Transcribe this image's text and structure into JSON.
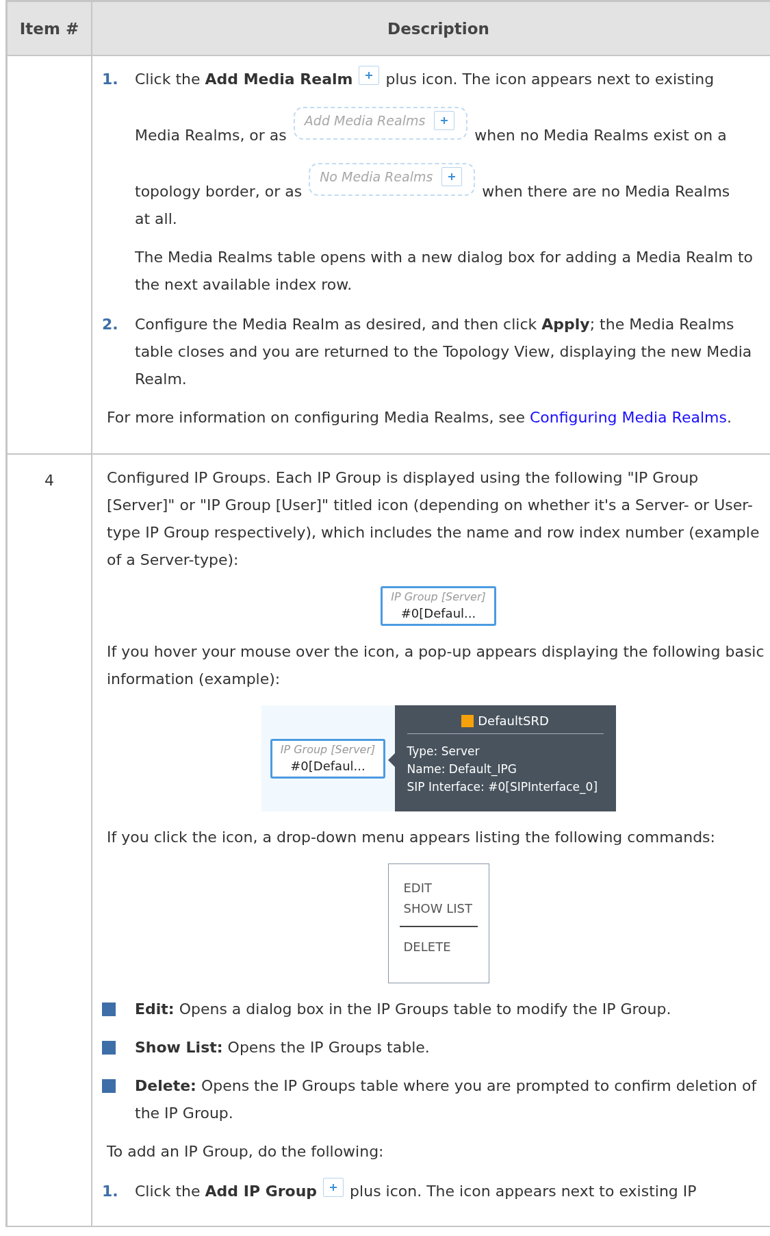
{
  "table": {
    "columns": [
      "Item #",
      "Description"
    ],
    "rows": [
      {
        "item": "",
        "blocks": [
          {
            "kind": "step",
            "number": "1.",
            "lines": [
              [
                {
                  "kind": "text",
                  "text": "Click the **Add Media Realm**"
                },
                {
                  "kind": "plus"
                },
                {
                  "kind": "text",
                  "text": "plus icon. The icon appears next to existing"
                }
              ],
              [
                {
                  "kind": "text",
                  "text": "Media Realms, or as"
                },
                {
                  "kind": "chip",
                  "label": "Add Media Realms"
                },
                {
                  "kind": "text",
                  "text": "when no Media Realms exist on a"
                }
              ],
              [
                {
                  "kind": "text",
                  "text": "topology border, or as"
                },
                {
                  "kind": "chip",
                  "label": "No Media Realms"
                },
                {
                  "kind": "text",
                  "text": "when there are no Media Realms"
                }
              ],
              [
                {
                  "kind": "text",
                  "text": "at all."
                }
              ]
            ]
          },
          {
            "kind": "note",
            "text": "The Media Realms table opens with a new dialog box for adding a Media Realm to the next available index row."
          },
          {
            "kind": "step",
            "number": "2.",
            "lines": [
              [
                {
                  "kind": "text",
                  "text": "Configure the Media Realm as desired, and then click **Apply**; the Media Realms table closes and you are returned to the Topology View, displaying the new Media Realm."
                }
              ]
            ]
          },
          {
            "kind": "link_para",
            "text": "For more information on configuring Media Realms, see ",
            "link": "Configuring Media Realms",
            "after": "."
          }
        ]
      },
      {
        "item": "4",
        "blocks": [
          {
            "kind": "para",
            "text": "Configured IP Groups. Each IP Group is displayed using the following \"IP Group [Server]\" or \"IP Group [User]\" titled icon (depending on whether it's a Server- or User-type IP Group respectively), which includes the name and row index number (example of a Server-type):"
          },
          {
            "kind": "node",
            "title": "IP Group [Server]",
            "name": "#0[Defaul..."
          },
          {
            "kind": "para",
            "text": "If you hover your mouse over the icon, a pop-up appears displaying the following basic information (example):"
          },
          {
            "kind": "popup",
            "node": {
              "title": "IP Group [Server]",
              "name": "#0[Defaul..."
            },
            "heading": "DefaultSRD",
            "lines": [
              "Type: Server",
              "Name: Default_IPG",
              "SIP Interface: #0[SIPInterface_0]"
            ]
          },
          {
            "kind": "para",
            "text": "If you click the icon, a drop-down menu appears listing the following commands:"
          },
          {
            "kind": "menu",
            "items": [
              {
                "label": "EDIT",
                "underlined": false
              },
              {
                "label": "SHOW LIST",
                "underlined": true
              },
              {
                "label": "DELETE",
                "underlined": false
              }
            ]
          },
          {
            "kind": "bullet",
            "text": "**Edit:** Opens a dialog box in the IP Groups table to modify the IP Group."
          },
          {
            "kind": "bullet",
            "text": "**Show List:** Opens the IP Groups table."
          },
          {
            "kind": "bullet",
            "text": "**Delete:** Opens the IP Groups table where you are prompted to confirm deletion of the IP Group."
          },
          {
            "kind": "para",
            "text": "To add an IP Group, do the following:"
          },
          {
            "kind": "step",
            "number": "1.",
            "lines": [
              [
                {
                  "kind": "text",
                  "text": "Click the **Add IP Group**"
                },
                {
                  "kind": "plus"
                },
                {
                  "kind": "text",
                  "text": "plus icon. The icon appears next to existing IP"
                }
              ]
            ]
          }
        ]
      }
    ]
  }
}
